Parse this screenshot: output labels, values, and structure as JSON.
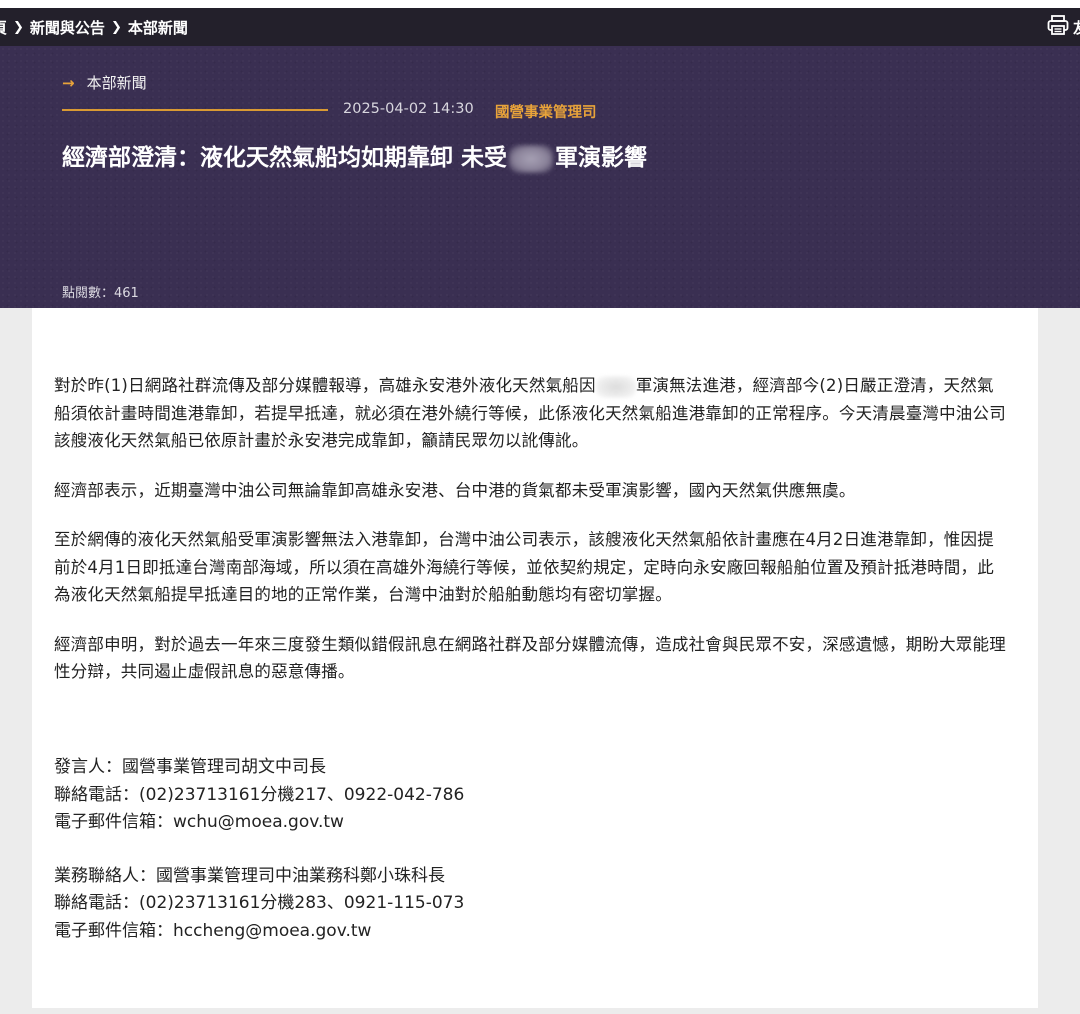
{
  "breadcrumb": {
    "items": [
      "頁",
      "新聞與公告",
      "本部新聞"
    ]
  },
  "print": {
    "label": "友"
  },
  "hero": {
    "category": "本部新聞",
    "date": "2025-04-02 14:30",
    "department": "國營事業管理司",
    "title_before": "經濟部澄清：液化天然氣船均如期靠卸 未受",
    "title_after": "軍演影響",
    "views": "點閱數：461"
  },
  "article": {
    "p1_before": "對於昨(1)日網路社群流傳及部分媒體報導，高雄永安港外液化天然氣船因",
    "p1_after": "軍演無法進港，經濟部今(2)日嚴正澄清，天然氣船須依計畫時間進港靠卸，若提早抵達，就必須在港外繞行等候，此係液化天然氣船進港靠卸的正常程序。今天清晨臺灣中油公司該艘液化天然氣船已依原計畫於永安港完成靠卸，籲請民眾勿以訛傳訛。",
    "p2": "經濟部表示，近期臺灣中油公司無論靠卸高雄永安港、台中港的貨氣都未受軍演影響，國內天然氣供應無虞。",
    "p3": "至於網傳的液化天然氣船受軍演影響無法入港靠卸，台灣中油公司表示，該艘液化天然氣船依計畫應在4月2日進港靠卸，惟因提前於4月1日即抵達台灣南部海域，所以須在高雄外海繞行等候，並依契約規定，定時向永安廠回報船舶位置及預計抵港時間，此為液化天然氣船提早抵達目的地的正常作業，台灣中油對於船舶動態均有密切掌握。",
    "p4": "經濟部申明，對於過去一年來三度發生類似錯假訊息在網路社群及部分媒體流傳，造成社會與民眾不安，深感遺憾，期盼大眾能理性分辯，共同遏止虛假訊息的惡意傳播。"
  },
  "contacts": [
    {
      "role": "發言人：國營事業管理司胡文中司長",
      "phone": "聯絡電話：(02)23713161分機217、0922-042-786",
      "email": "電子郵件信箱：wchu@moea.gov.tw"
    },
    {
      "role": "業務聯絡人：國營事業管理司中油業務科鄭小珠科長",
      "phone": "聯絡電話：(02)23713161分機283、0921-115-073",
      "email": "電子郵件信箱：hccheng@moea.gov.tw"
    }
  ],
  "colors": {
    "hero_bg": "#3a2f52",
    "accent": "#e8a33a",
    "topbar": "#23202b"
  }
}
